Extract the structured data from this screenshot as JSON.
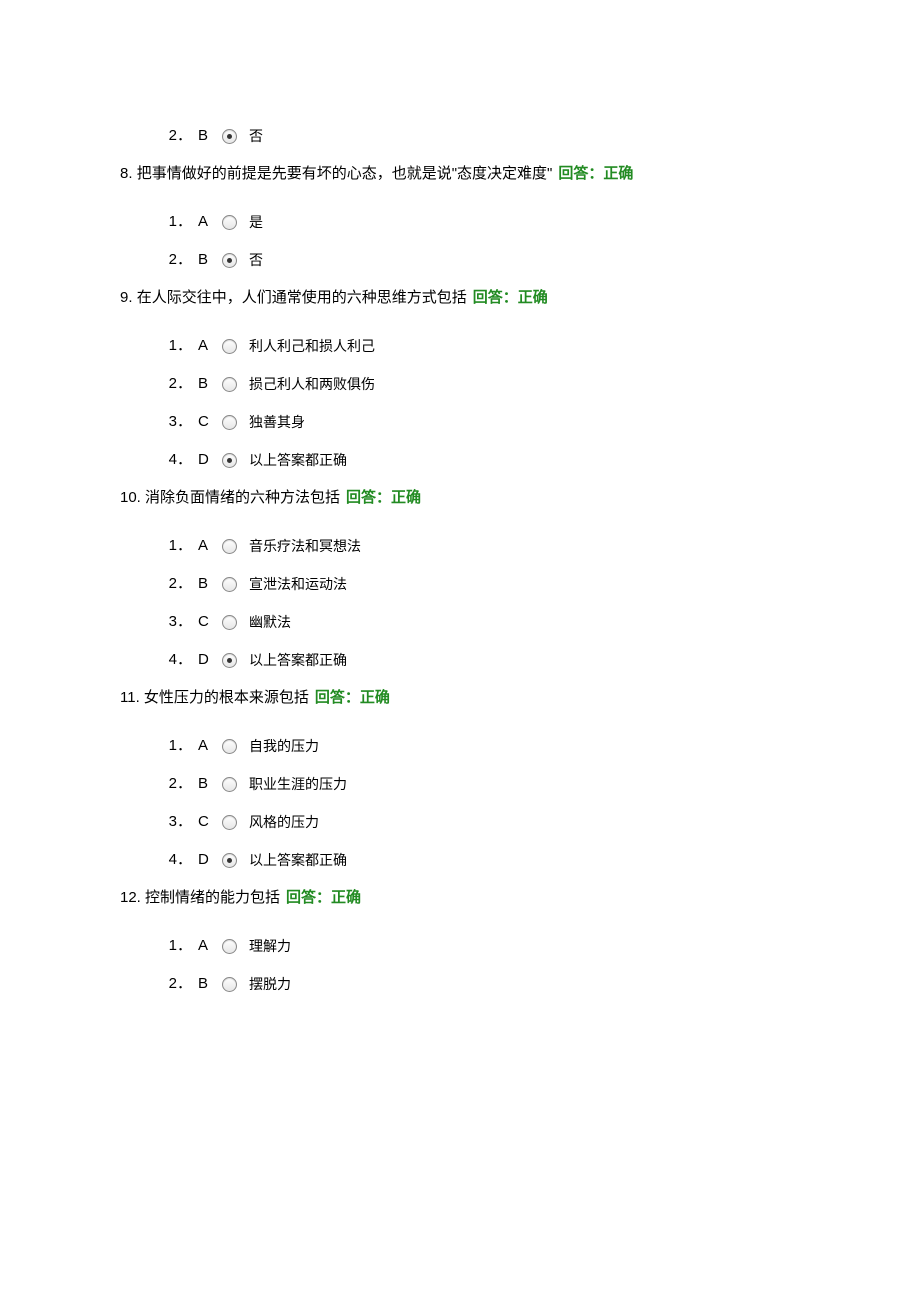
{
  "questions": [
    {
      "num": "",
      "text": "",
      "status": "",
      "options": [
        {
          "idx": "2．",
          "letter": "B",
          "selected": true,
          "label": "否"
        }
      ]
    },
    {
      "num": "8.",
      "text": "把事情做好的前提是先要有坏的心态，也就是说\"态度决定难度\"",
      "status": "回答：正确",
      "options": [
        {
          "idx": "1．",
          "letter": "A",
          "selected": false,
          "label": "是"
        },
        {
          "idx": "2．",
          "letter": "B",
          "selected": true,
          "label": "否"
        }
      ]
    },
    {
      "num": "9.",
      "text": "在人际交往中，人们通常使用的六种思维方式包括",
      "status": "回答：正确",
      "options": [
        {
          "idx": "1．",
          "letter": "A",
          "selected": false,
          "label": "利人利己和损人利己"
        },
        {
          "idx": "2．",
          "letter": "B",
          "selected": false,
          "label": "损己利人和两败俱伤"
        },
        {
          "idx": "3．",
          "letter": "C",
          "selected": false,
          "label": "独善其身"
        },
        {
          "idx": "4．",
          "letter": "D",
          "selected": true,
          "label": "以上答案都正确"
        }
      ]
    },
    {
      "num": "10.",
      "text": "消除负面情绪的六种方法包括",
      "status": "回答：正确",
      "options": [
        {
          "idx": "1．",
          "letter": "A",
          "selected": false,
          "label": "音乐疗法和冥想法"
        },
        {
          "idx": "2．",
          "letter": "B",
          "selected": false,
          "label": "宣泄法和运动法"
        },
        {
          "idx": "3．",
          "letter": "C",
          "selected": false,
          "label": "幽默法"
        },
        {
          "idx": "4．",
          "letter": "D",
          "selected": true,
          "label": "以上答案都正确"
        }
      ]
    },
    {
      "num": "11.",
      "text": "女性压力的根本来源包括",
      "status": "回答：正确",
      "options": [
        {
          "idx": "1．",
          "letter": "A",
          "selected": false,
          "label": "自我的压力"
        },
        {
          "idx": "2．",
          "letter": "B",
          "selected": false,
          "label": "职业生涯的压力"
        },
        {
          "idx": "3．",
          "letter": "C",
          "selected": false,
          "label": "风格的压力"
        },
        {
          "idx": "4．",
          "letter": "D",
          "selected": true,
          "label": "以上答案都正确"
        }
      ]
    },
    {
      "num": "12.",
      "text": "控制情绪的能力包括",
      "status": "回答：正确",
      "options": [
        {
          "idx": "1．",
          "letter": "A",
          "selected": false,
          "label": "理解力"
        },
        {
          "idx": "2．",
          "letter": "B",
          "selected": false,
          "label": "摆脱力"
        }
      ]
    }
  ]
}
